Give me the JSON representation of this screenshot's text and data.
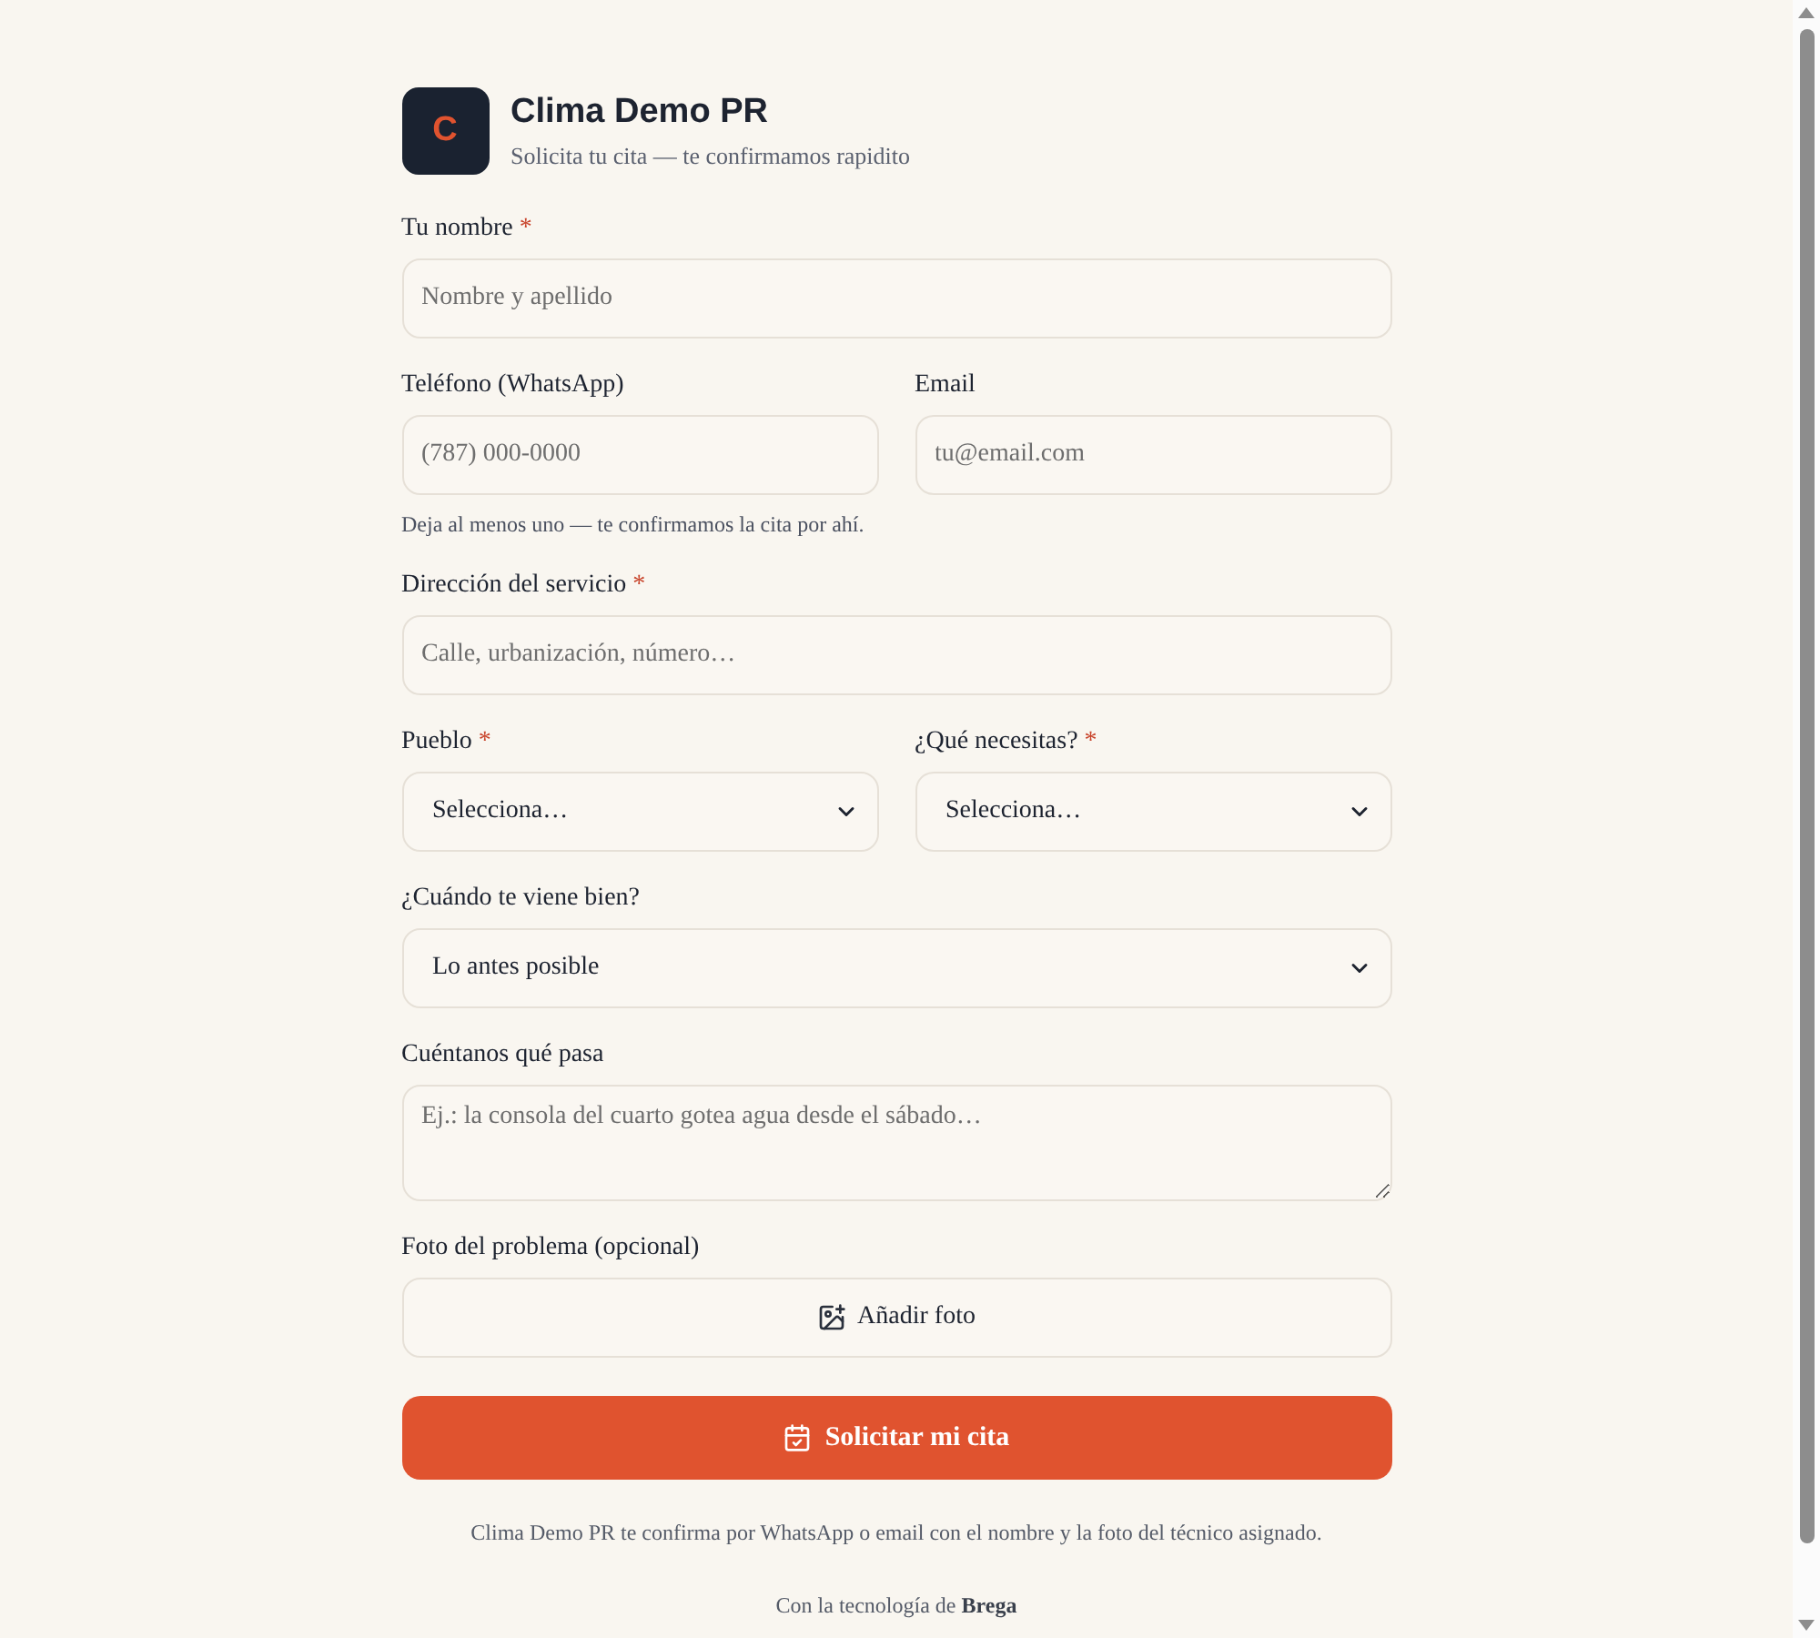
{
  "header": {
    "logo_letter": "C",
    "title": "Clima Demo PR",
    "subtitle": "Solicita tu cita — te confirmamos rapidito"
  },
  "form": {
    "rows": [
      {
        "fields": [
          {
            "kind": "text",
            "label": "Tu nombre",
            "required_mark": "*",
            "placeholder": "Nombre y apellido"
          }
        ]
      },
      {
        "fields": [
          {
            "kind": "text",
            "label": "Teléfono (WhatsApp)",
            "placeholder": "(787) 000-0000"
          },
          {
            "kind": "text",
            "label": "Email",
            "placeholder": "tu@email.com"
          }
        ],
        "hint": "Deja al menos uno — te confirmamos la cita por ahí."
      },
      {
        "fields": [
          {
            "kind": "text",
            "label": "Dirección del servicio",
            "required_mark": "*",
            "placeholder": "Calle, urbanización, número…"
          }
        ]
      },
      {
        "fields": [
          {
            "kind": "select",
            "label": "Pueblo",
            "required_mark": "*",
            "value": "Selecciona…"
          },
          {
            "kind": "select",
            "label": "¿Qué necesitas?",
            "required_mark": "*",
            "value": "Selecciona…"
          }
        ]
      },
      {
        "fields": [
          {
            "kind": "select",
            "label": "¿Cuándo te viene bien?",
            "value": "Lo antes posible"
          }
        ]
      },
      {
        "fields": [
          {
            "kind": "textarea",
            "label": "Cuéntanos qué pasa",
            "placeholder": "Ej.: la consola del cuarto gotea agua desde el sábado…"
          }
        ]
      },
      {
        "fields": [
          {
            "kind": "upload",
            "label": "Foto del problema (opcional)",
            "button": "Añadir foto"
          }
        ]
      }
    ],
    "submit": "Solicitar mi cita"
  },
  "footer": {
    "note": "Clima Demo PR te confirma por WhatsApp o email con el nombre y la foto del técnico asignado.",
    "credit": "Con la tecnología de **Brega**"
  }
}
